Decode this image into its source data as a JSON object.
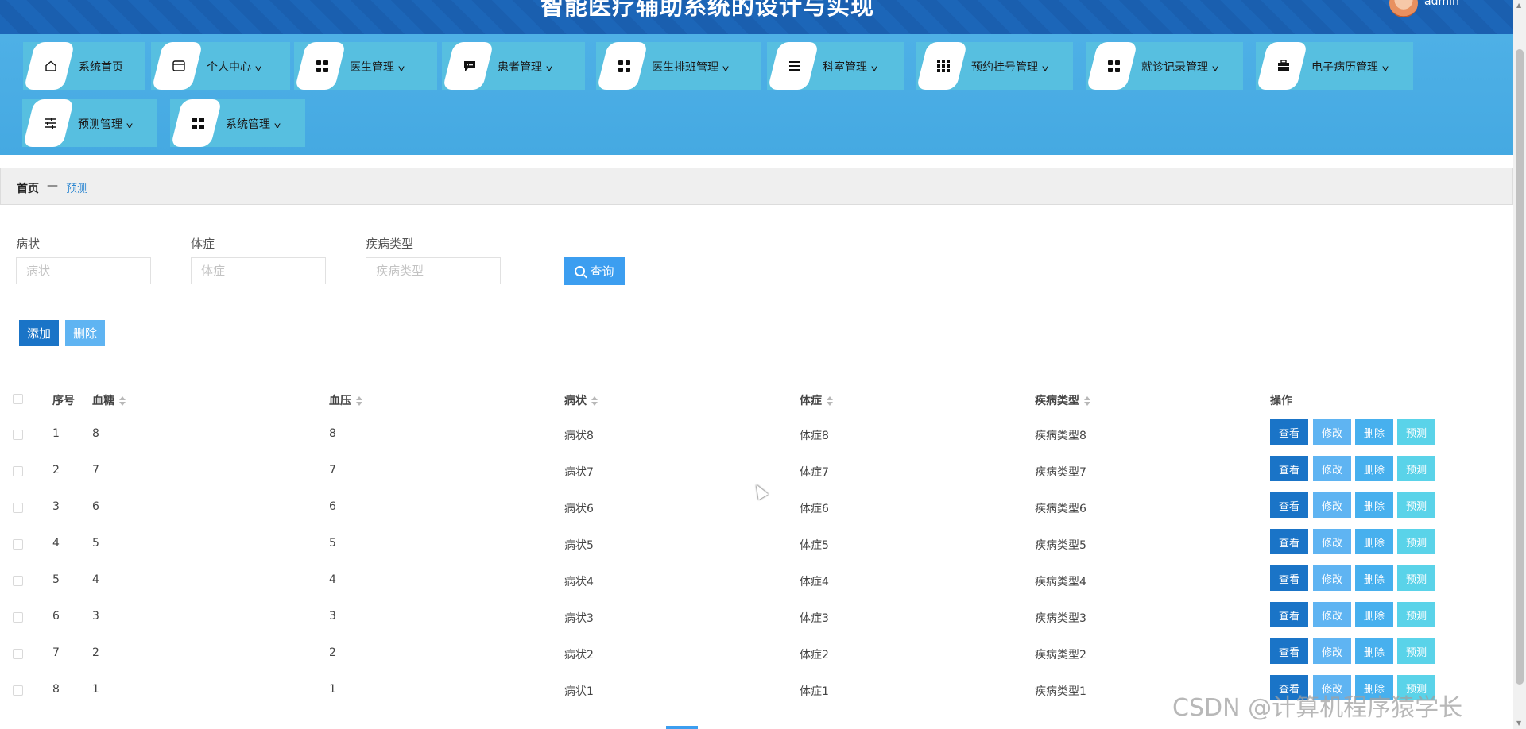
{
  "header": {
    "title": "智能医疗辅助系统的设计与实现",
    "username": "admin"
  },
  "nav": {
    "items": [
      {
        "label": "系统首页",
        "icon": "home-icon",
        "dropdown": false
      },
      {
        "label": "个人中心",
        "icon": "wallet-icon",
        "dropdown": true
      },
      {
        "label": "医生管理",
        "icon": "grid-icon",
        "dropdown": true
      },
      {
        "label": "患者管理",
        "icon": "chat-icon",
        "dropdown": true
      },
      {
        "label": "医生排班管理",
        "icon": "grid-icon",
        "dropdown": true
      },
      {
        "label": "科室管理",
        "icon": "menu-icon",
        "dropdown": true
      },
      {
        "label": "预约挂号管理",
        "icon": "apps-icon",
        "dropdown": true
      },
      {
        "label": "就诊记录管理",
        "icon": "grid-icon",
        "dropdown": true
      },
      {
        "label": "电子病历管理",
        "icon": "briefcase-icon",
        "dropdown": true
      },
      {
        "label": "预测管理",
        "icon": "sliders-icon",
        "dropdown": true
      },
      {
        "label": "系统管理",
        "icon": "grid-icon",
        "dropdown": true
      }
    ]
  },
  "breadcrumb": {
    "home": "首页",
    "separator": "—",
    "current": "预测"
  },
  "search": {
    "fields": [
      {
        "label": "病状",
        "placeholder": "病状",
        "value": ""
      },
      {
        "label": "体症",
        "placeholder": "体症",
        "value": ""
      },
      {
        "label": "疾病类型",
        "placeholder": "疾病类型",
        "value": ""
      }
    ],
    "query_label": "查询"
  },
  "toolbar": {
    "add_label": "添加",
    "delete_label": "删除"
  },
  "table": {
    "columns": [
      "序号",
      "血糖",
      "血压",
      "病状",
      "体症",
      "疾病类型",
      "操作"
    ],
    "rows": [
      {
        "index": "1",
        "blood_sugar": "8",
        "blood_pressure": "8",
        "symptom": "病状8",
        "sign": "体症8",
        "disease_type": "疾病类型8"
      },
      {
        "index": "2",
        "blood_sugar": "7",
        "blood_pressure": "7",
        "symptom": "病状7",
        "sign": "体症7",
        "disease_type": "疾病类型7"
      },
      {
        "index": "3",
        "blood_sugar": "6",
        "blood_pressure": "6",
        "symptom": "病状6",
        "sign": "体症6",
        "disease_type": "疾病类型6"
      },
      {
        "index": "4",
        "blood_sugar": "5",
        "blood_pressure": "5",
        "symptom": "病状5",
        "sign": "体症5",
        "disease_type": "疾病类型5"
      },
      {
        "index": "5",
        "blood_sugar": "4",
        "blood_pressure": "4",
        "symptom": "病状4",
        "sign": "体症4",
        "disease_type": "疾病类型4"
      },
      {
        "index": "6",
        "blood_sugar": "3",
        "blood_pressure": "3",
        "symptom": "病状3",
        "sign": "体症3",
        "disease_type": "疾病类型3"
      },
      {
        "index": "7",
        "blood_sugar": "2",
        "blood_pressure": "2",
        "symptom": "病状2",
        "sign": "体症2",
        "disease_type": "疾病类型2"
      },
      {
        "index": "8",
        "blood_sugar": "1",
        "blood_pressure": "1",
        "symptom": "病状1",
        "sign": "体症1",
        "disease_type": "疾病类型1"
      }
    ],
    "actions": {
      "view": "查看",
      "edit": "修改",
      "delete": "删除",
      "predict": "预测"
    }
  },
  "watermark": "CSDN @计算机程序猿学长",
  "colors": {
    "primary": "#1a74c7",
    "nav_bg": "#4eb0e6",
    "accent": "#3c9ef0"
  }
}
